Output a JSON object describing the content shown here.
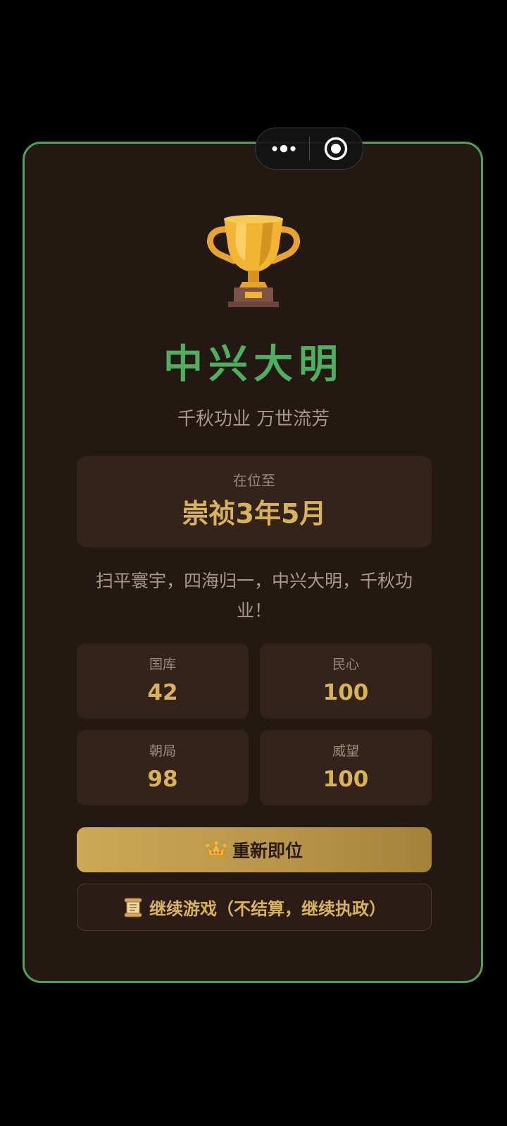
{
  "menu_capsule": {
    "more_icon": "more-dots-icon",
    "close_icon": "target-circle-icon"
  },
  "ending": {
    "icon": "trophy-icon",
    "title": "中兴大明",
    "subtitle": "千秋功业 万世流芳",
    "reign_label": "在位至",
    "reign_value": "崇祯3年5月",
    "message": "扫平寰宇，四海归一，中兴大明，千秋功业！"
  },
  "stats": [
    {
      "label": "国库",
      "value": "42"
    },
    {
      "label": "民心",
      "value": "100"
    },
    {
      "label": "朝局",
      "value": "98"
    },
    {
      "label": "威望",
      "value": "100"
    }
  ],
  "buttons": {
    "restart": {
      "icon": "crown-icon",
      "label": "重新即位"
    },
    "continue": {
      "icon": "scroll-icon",
      "label": "继续游戏（不结算，继续执政）"
    }
  },
  "colors": {
    "frame_border": "#4fa05d",
    "title": "#4fae60",
    "gold": "#d8b35a",
    "panel": "#33231a",
    "card_bg": "#241813"
  }
}
